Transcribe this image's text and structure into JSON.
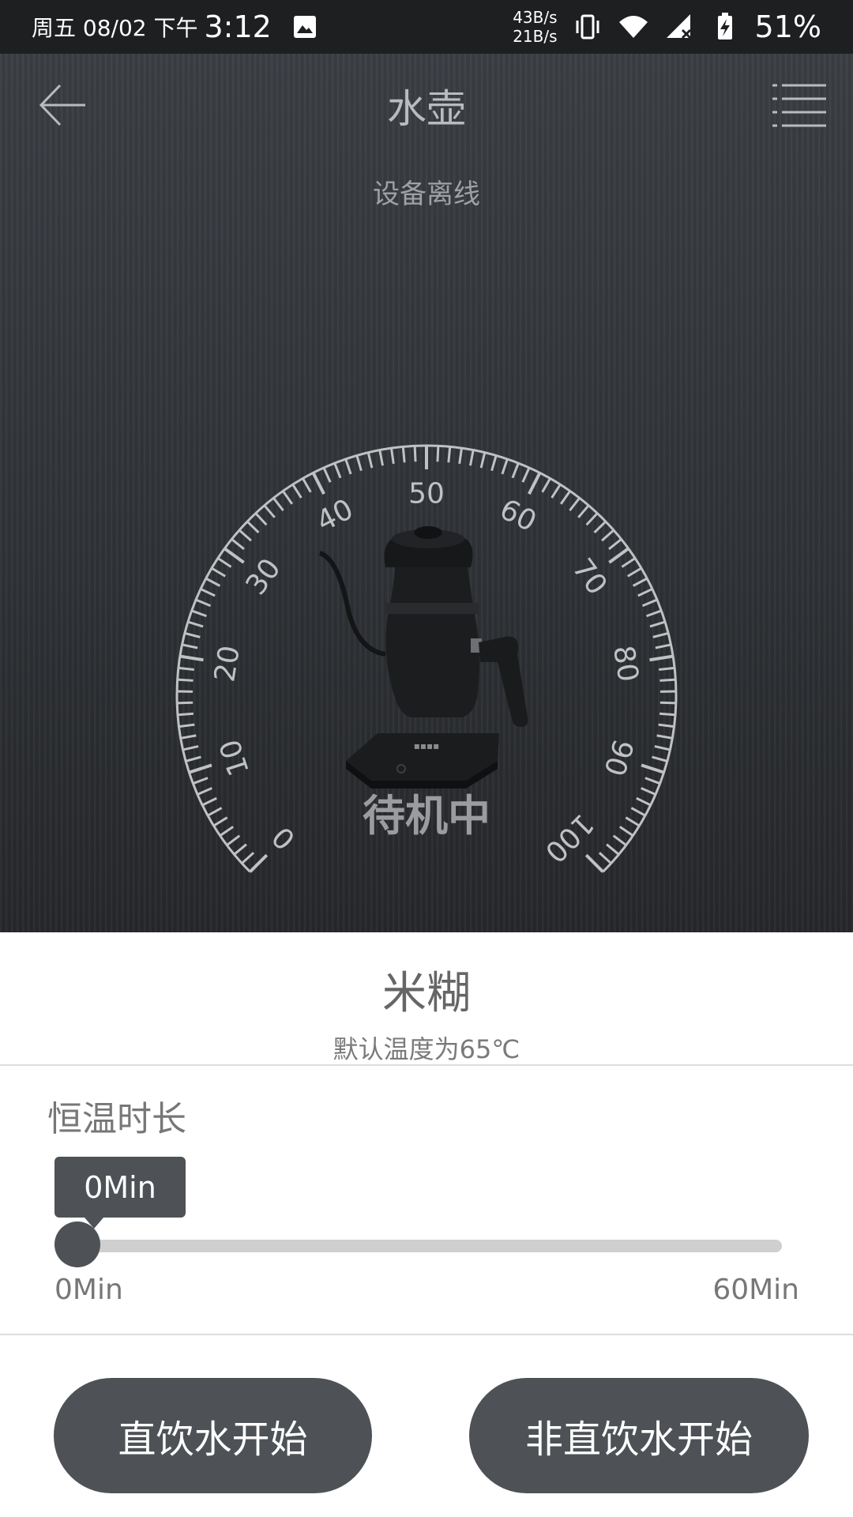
{
  "status_bar": {
    "date": "周五 08/02 下午",
    "time": "3:12",
    "net_up": "43B/s",
    "net_down": "21B/s",
    "battery": "51%",
    "icons": [
      "image-icon",
      "vibrate-icon",
      "wifi-icon",
      "signal-no-sim-icon",
      "battery-charging-icon"
    ]
  },
  "header": {
    "title": "水壶",
    "subtitle": "设备离线",
    "back_icon": "arrow-left-icon",
    "menu_icon": "list-menu-icon"
  },
  "gauge": {
    "labels": [
      "0",
      "10",
      "20",
      "30",
      "40",
      "50",
      "60",
      "70",
      "80",
      "90",
      "100"
    ],
    "min": 0,
    "max": 100,
    "image": "kettle-image"
  },
  "device_status": "待机中",
  "recipe": {
    "name": "米糊",
    "description": "默认温度为65℃"
  },
  "timer": {
    "title": "恒温时长",
    "value_label": "0Min",
    "value_fraction": 0,
    "min_label": "0Min",
    "max_label": "60Min"
  },
  "actions": {
    "direct_label": "直饮水开始",
    "non_direct_label": "非直饮水开始"
  },
  "colors": {
    "button": "#4e5256",
    "track": "#cfcfcf",
    "background_dark": "#2f3236"
  }
}
